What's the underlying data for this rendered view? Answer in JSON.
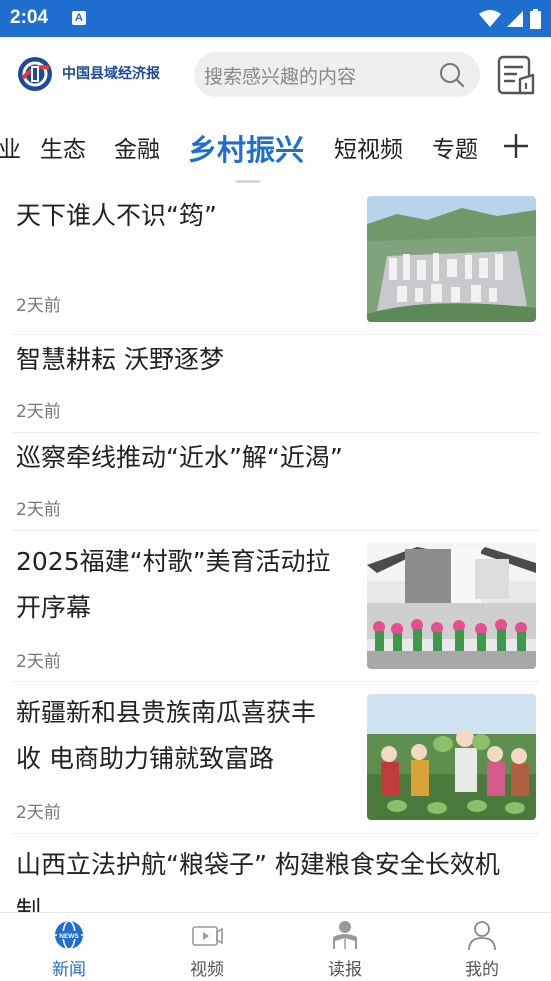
{
  "status_bar": {
    "time": "2:04",
    "app_badge": "A"
  },
  "header": {
    "logo_text": "中国县域经济报",
    "search_placeholder": "搜索感兴趣的内容"
  },
  "tabs": [
    {
      "label": "业"
    },
    {
      "label": "生态"
    },
    {
      "label": "金融"
    },
    {
      "label": "乡村振兴",
      "active": true
    },
    {
      "label": "短视频"
    },
    {
      "label": "专题"
    }
  ],
  "news": [
    {
      "title_lines": [
        "天下谁人不识“筠”"
      ],
      "time": "2天前",
      "has_image": true,
      "image_icon": "city-aerial-photo"
    },
    {
      "title_lines": [
        "智慧耕耘 沃野逐梦"
      ],
      "time": "2天前",
      "has_image": false
    },
    {
      "title_lines": [
        "巡察牵线推动“近水”解“近渴”"
      ],
      "time": "2天前",
      "has_image": false
    },
    {
      "title_lines": [
        "2025福建“村歌”美育活动拉",
        "开序幕"
      ],
      "time": "2天前",
      "has_image": true,
      "image_icon": "village-performance-photo"
    },
    {
      "title_lines": [
        "新疆新和县贵族南瓜喜获丰",
        "收 电商助力铺就致富路"
      ],
      "time": "2天前",
      "has_image": true,
      "image_icon": "pumpkin-harvest-photo"
    },
    {
      "title_lines": [
        "山西立法护航“粮袋子” 构建粮食安全长效机",
        "制"
      ],
      "time": "",
      "has_image": false
    }
  ],
  "bottom_nav": [
    {
      "label": "新闻",
      "icon": "globe-news-icon",
      "active": true
    },
    {
      "label": "视频",
      "icon": "video-icon"
    },
    {
      "label": "读报",
      "icon": "reader-icon"
    },
    {
      "label": "我的",
      "icon": "profile-icon"
    }
  ],
  "colors": {
    "brand": "#1e6fd0",
    "text": "#222222",
    "muted": "#777777"
  }
}
